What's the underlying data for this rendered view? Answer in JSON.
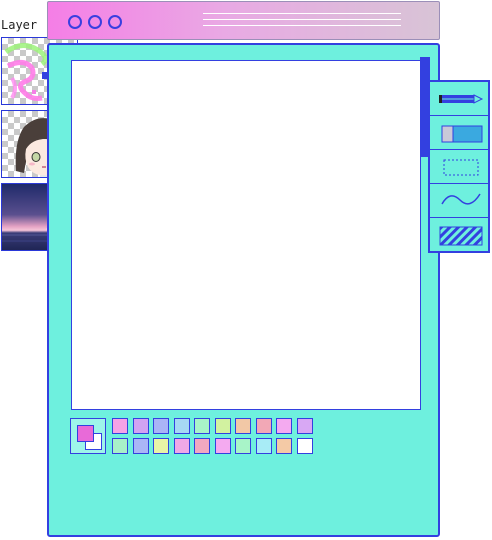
{
  "layer_panel": {
    "title": "Layer",
    "layers": [
      {
        "name": "doodle-layer"
      },
      {
        "name": "portrait-layer"
      },
      {
        "name": "sunset-layer"
      }
    ]
  },
  "window": {
    "buttons": [
      "minimize",
      "maximize",
      "close"
    ],
    "accent": "#3340e0",
    "body_color": "#6ef0de"
  },
  "tools": [
    {
      "name": "pencil-tool",
      "icon": "pencil-icon"
    },
    {
      "name": "eraser-tool",
      "icon": "eraser-icon"
    },
    {
      "name": "select-tool",
      "icon": "dotted-rect-icon"
    },
    {
      "name": "curve-tool",
      "icon": "wave-icon"
    },
    {
      "name": "fill-tool",
      "icon": "hatch-icon"
    }
  ],
  "palette": {
    "foreground": "#e86ad8",
    "background": "#ffffff",
    "row1": [
      "#f6a3e6",
      "#d2a3f2",
      "#aab4f6",
      "#a6d8f4",
      "#a8f4c8",
      "#d2f2a0",
      "#f2c8a6",
      "#f2a8b6",
      "#f4aaf0",
      "#d8a8f4"
    ],
    "row2": [
      "#a8f0c8",
      "#aab6f6",
      "#e8f4a6",
      "#f0a8e6",
      "#f2a8c0",
      "#f4aaf0",
      "#a8f4c8",
      "#a8ecf6",
      "#f4caa6",
      "#ffffff"
    ]
  }
}
